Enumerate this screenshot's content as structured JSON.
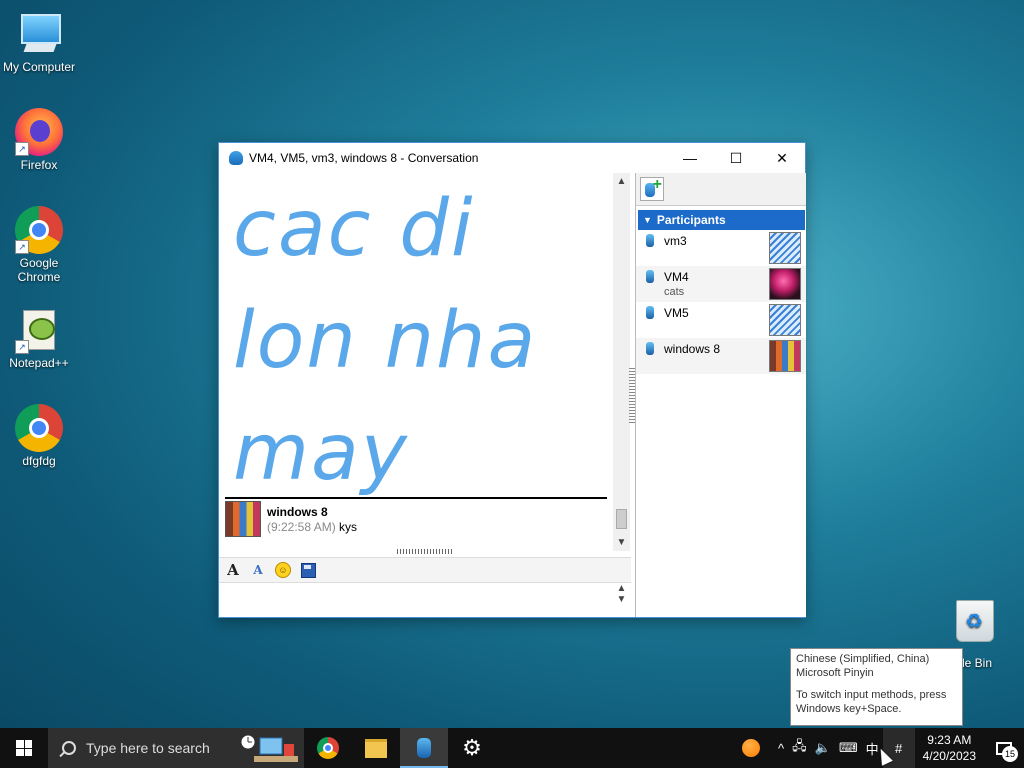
{
  "desktop": {
    "icons": [
      {
        "label": "My Computer"
      },
      {
        "label": "Firefox"
      },
      {
        "label": "Google Chrome"
      },
      {
        "label": "Notepad++"
      },
      {
        "label": "dfgfdg"
      }
    ],
    "recycle_bin_label": "ycle Bin"
  },
  "window": {
    "title": "VM4, VM5, vm3, windows 8 - Conversation",
    "big_message_lines": [
      "cac di",
      "lon nha",
      "may"
    ],
    "last_message": {
      "sender": "windows 8",
      "time": "(9:22:58 AM)",
      "text": "kys"
    },
    "participants_header": "Participants",
    "participants": [
      {
        "name": "vm3",
        "status": ""
      },
      {
        "name": "VM4",
        "status": "cats"
      },
      {
        "name": "VM5",
        "status": ""
      },
      {
        "name": "windows 8",
        "status": ""
      }
    ],
    "accent_color": "#1c6ac9",
    "message_color": "#5aa8ea"
  },
  "tooltip": {
    "line1": "Chinese (Simplified, China)",
    "line2": "Microsoft Pinyin",
    "line3": "To switch input methods, press",
    "line4": "Windows key+Space."
  },
  "taskbar": {
    "search_placeholder": "Type here to search",
    "ime_label": "中",
    "time": "9:23 AM",
    "date": "4/20/2023",
    "notification_count": "15"
  }
}
